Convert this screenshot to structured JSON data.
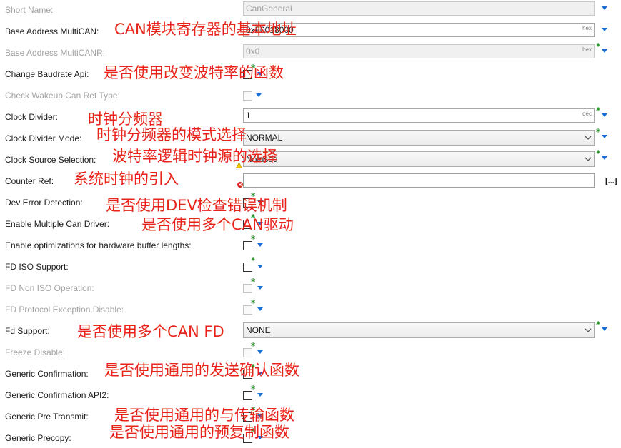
{
  "rows": [
    {
      "label": "Short Name:",
      "value": "CanGeneral",
      "disabled": true
    },
    {
      "label": "Base Address MultiCAN:",
      "value": "0xF0018000",
      "suffix": "hex"
    },
    {
      "label": "Base Address MultiCANR:",
      "value": "0x0",
      "suffix": "hex",
      "disabled": true
    },
    {
      "label": "Change Baudrate Api:",
      "checked": false
    },
    {
      "label": "Check Wakeup Can Ret Type:",
      "checked": false,
      "disabled": true
    },
    {
      "label": "Clock Divider:",
      "value": "1",
      "suffix": "dec"
    },
    {
      "label": "Clock Divider Mode:",
      "value": "NORMAL"
    },
    {
      "label": "Clock Source Selection:",
      "value": "Notused"
    },
    {
      "label": "Counter Ref:",
      "browse_label": "[...]"
    },
    {
      "label": "Dev Error Detection:",
      "checked": false
    },
    {
      "label": "Enable Multiple Can Driver:",
      "checked": false
    },
    {
      "label": "Enable optimizations for hardware buffer lengths:",
      "checked": false
    },
    {
      "label": "FD ISO Support:",
      "checked": false
    },
    {
      "label": "FD Non ISO Operation:",
      "checked": false,
      "disabled": true
    },
    {
      "label": "FD Protocol Exception Disable:",
      "checked": false,
      "disabled": true
    },
    {
      "label": "Fd Support:",
      "value": "NONE"
    },
    {
      "label": "Freeze Disable:",
      "checked": false,
      "disabled": true
    },
    {
      "label": "Generic Confirmation:",
      "checked": false
    },
    {
      "label": "Generic Confirmation API2:",
      "checked": false
    },
    {
      "label": "Generic Pre Transmit:",
      "checked": false
    },
    {
      "label": "Generic Precopy:",
      "checked": false
    }
  ],
  "modified_marker": "*",
  "annotations": [
    "CAN模块寄存器的基本地址",
    "是否使用改变波特率的函数",
    "时钟分频器",
    "时钟分频器的模式选择",
    "波特率逻辑时钟源的选择",
    "系统时钟的引入",
    "是否使用DEV检查错误机制",
    "是否使用多个CAN驱动",
    "是否使用多个CAN FD",
    "是否使用通用的发送确认函数",
    "是否使用通用的与传输函数",
    "是否使用通用的预复制函数"
  ],
  "icons": {
    "dropdown": "triangle-down-icon",
    "select": "chevron-down-icon",
    "warning": "warning-icon",
    "error": "error-icon"
  },
  "colors": {
    "annotation": "#e8231a",
    "dropdown_arrow": "#1a6fd6",
    "modified_marker": "#2b962b",
    "disabled_text": "#a3a3a3",
    "warning": "#f2c200",
    "error": "#d9261c"
  }
}
